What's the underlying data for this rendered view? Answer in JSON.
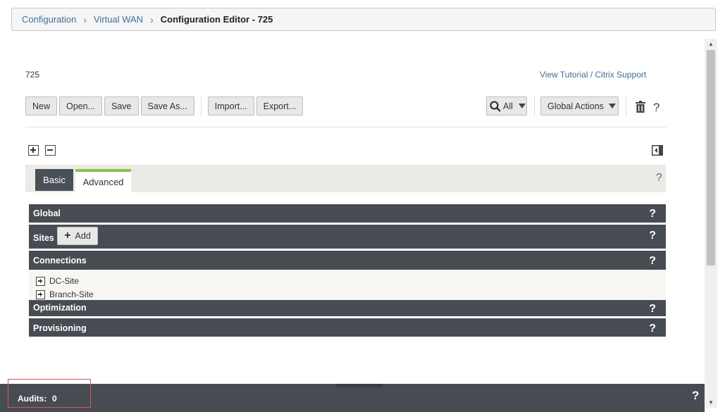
{
  "breadcrumb": {
    "items": [
      "Configuration",
      "Virtual WAN"
    ],
    "current": "Configuration Editor - 725",
    "separator": "›"
  },
  "config_name": "725",
  "help_links": {
    "tutorial": "View Tutorial",
    "separator": " / ",
    "support": "Citrix Support"
  },
  "toolbar": {
    "new": "New",
    "open": "Open...",
    "save": "Save",
    "save_as": "Save As...",
    "import": "Import...",
    "export": "Export...",
    "filter_value": "All",
    "global_actions": "Global Actions",
    "help": "?"
  },
  "tabs": {
    "basic": "Basic",
    "advanced": "Advanced",
    "help": "?"
  },
  "sections": {
    "global": "Global",
    "sites": "Sites",
    "sites_add": "Add",
    "connections": "Connections",
    "connections_items": [
      "DC-Site",
      "Branch-Site"
    ],
    "optimization": "Optimization",
    "provisioning": "Provisioning",
    "help": "?"
  },
  "audits": {
    "label": "Audits:",
    "count": "0",
    "help": "?"
  },
  "colors": {
    "section_bg": "#474c53",
    "tab_active_accent": "#8bc34a",
    "link": "#3f6f9a",
    "highlight_border": "#e05050"
  },
  "icons": [
    "chevron-right-icon",
    "search-icon",
    "caret-down-icon",
    "trash-icon",
    "help-icon",
    "expand-all-icon",
    "collapse-all-icon",
    "panel-toggle-icon",
    "plus-icon",
    "tree-expand-icon"
  ]
}
